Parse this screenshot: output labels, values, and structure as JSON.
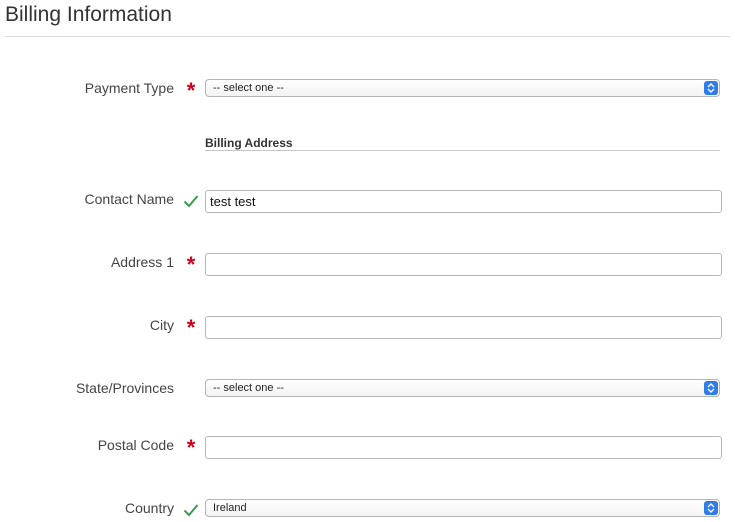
{
  "page": {
    "title": "Billing Information"
  },
  "colors": {
    "required": "#d0021b",
    "valid": "#3a9b4f",
    "select_arrow": "#2f7de8"
  },
  "form": {
    "payment_type": {
      "label": "Payment Type",
      "status_icon": "required-asterisk-icon",
      "value": "-- select one --"
    },
    "billing_address_heading": "Billing Address",
    "contact_name": {
      "label": "Contact Name",
      "status_icon": "checkmark-icon",
      "value": "test test"
    },
    "address1": {
      "label": "Address 1",
      "status_icon": "required-asterisk-icon",
      "value": ""
    },
    "city": {
      "label": "City",
      "status_icon": "required-asterisk-icon",
      "value": ""
    },
    "state": {
      "label": "State/Provinces",
      "value": "-- select one --"
    },
    "postal_code": {
      "label": "Postal Code",
      "status_icon": "required-asterisk-icon",
      "value": ""
    },
    "country": {
      "label": "Country",
      "status_icon": "checkmark-icon",
      "value": "Ireland"
    }
  }
}
